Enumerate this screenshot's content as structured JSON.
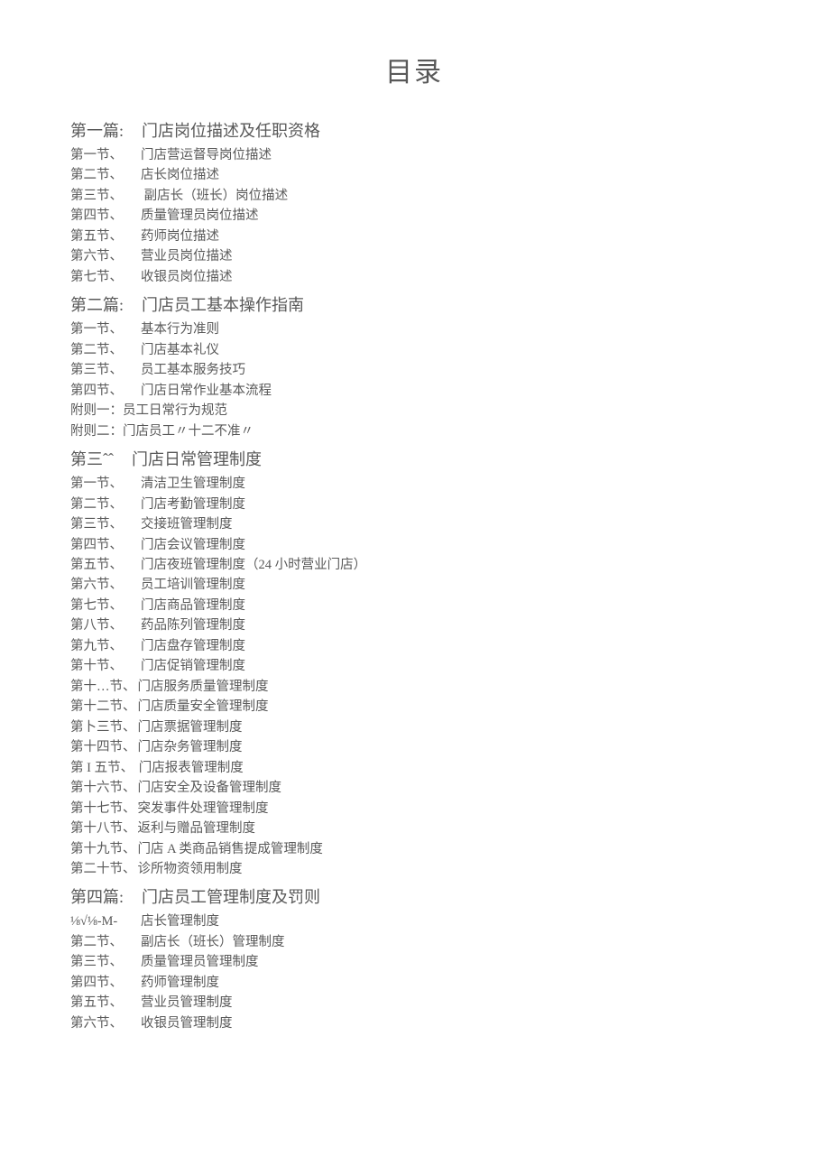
{
  "title": "目录",
  "chapters": [
    {
      "label": "第一篇:",
      "title": "门店岗位描述及任职资格",
      "sections": [
        {
          "label": "第一节、",
          "title": "门店营运督导岗位描述"
        },
        {
          "label": "第二节、",
          "title": "店长岗位描述"
        },
        {
          "label": "第三节、",
          "title": "  副店长（班长）岗位描述"
        },
        {
          "label": "第四节、",
          "title": "质量管理员岗位描述"
        },
        {
          "label": "第五节、",
          "title": "药师岗位描述"
        },
        {
          "label": "第六节、",
          "title": "营业员岗位描述"
        },
        {
          "label": "第七节、",
          "title": "收银员岗位描述"
        }
      ]
    },
    {
      "label": "第二篇:",
      "title": "门店员工基本操作指南",
      "sections": [
        {
          "label": "第一节、",
          "title": "基本行为准则"
        },
        {
          "label": "第二节、",
          "title": "门店基本礼仪"
        },
        {
          "label": "第三节、",
          "title": "员工基本服务技巧"
        },
        {
          "label": "第四节、",
          "title": "门店日常作业基本流程"
        }
      ],
      "appendices": [
        {
          "text": "附则一：员工日常行为规范"
        },
        {
          "text": "附则二：门店员工〃十二不准〃"
        }
      ]
    },
    {
      "label": "第三ˆˆ",
      "title": "门店日常管理制度",
      "sections": [
        {
          "label": "第一节、",
          "title": "清洁卫生管理制度"
        },
        {
          "label": "第二节、",
          "title": "门店考勤管理制度"
        },
        {
          "label": "第三节、",
          "title": "交接班管理制度"
        },
        {
          "label": "第四节、",
          "title": "门店会议管理制度"
        },
        {
          "label": "第五节、",
          "title": "门店夜班管理制度（24 小时营业门店）"
        },
        {
          "label": "第六节、",
          "title": "员工培训管理制度"
        },
        {
          "label": "第七节、",
          "title": "门店商品管理制度"
        },
        {
          "label": "第八节、",
          "title": "药品陈列管理制度"
        },
        {
          "label": "第九节、",
          "title": "门店盘存管理制度"
        },
        {
          "label": "第十节、",
          "title": "门店促销管理制度"
        },
        {
          "label": "第十…节、",
          "title": "门店服务质量管理制度",
          "wide": true
        },
        {
          "label": "第十二节、",
          "title": "门店质量安全管理制度",
          "wide": true
        },
        {
          "label": "第卜三节、",
          "title": "门店票据管理制度",
          "wide": true
        },
        {
          "label": "第十四节、",
          "title": "门店杂务管理制度",
          "wide": true
        },
        {
          "label": "第 I 五节、",
          "title": " 门店报表管理制度",
          "wide": true
        },
        {
          "label": "第十六节、",
          "title": "门店安全及设备管理制度",
          "wide": true
        },
        {
          "label": "第十七节、",
          "title": "突发事件处理管理制度",
          "wide": true
        },
        {
          "label": "第十八节、",
          "title": "返利与赠品管理制度",
          "wide": true
        },
        {
          "label": "第十九节、",
          "title": "门店 A 类商品销售提成管理制度",
          "wide": true
        },
        {
          "label": "第二十节、",
          "title": "诊所物资领用制度",
          "wide": true
        }
      ]
    },
    {
      "label": "第四篇:",
      "title": "门店员工管理制度及罚则",
      "sections": [
        {
          "label": "⅛√⅛-M-",
          "title": "店长管理制度"
        },
        {
          "label": "第二节、",
          "title": "副店长（班长）管理制度"
        },
        {
          "label": "第三节、",
          "title": "质量管理员管理制度"
        },
        {
          "label": "第四节、",
          "title": "药师管理制度"
        },
        {
          "label": "第五节、",
          "title": "营业员管理制度"
        },
        {
          "label": "第六节、",
          "title": "收银员管理制度"
        }
      ]
    }
  ]
}
